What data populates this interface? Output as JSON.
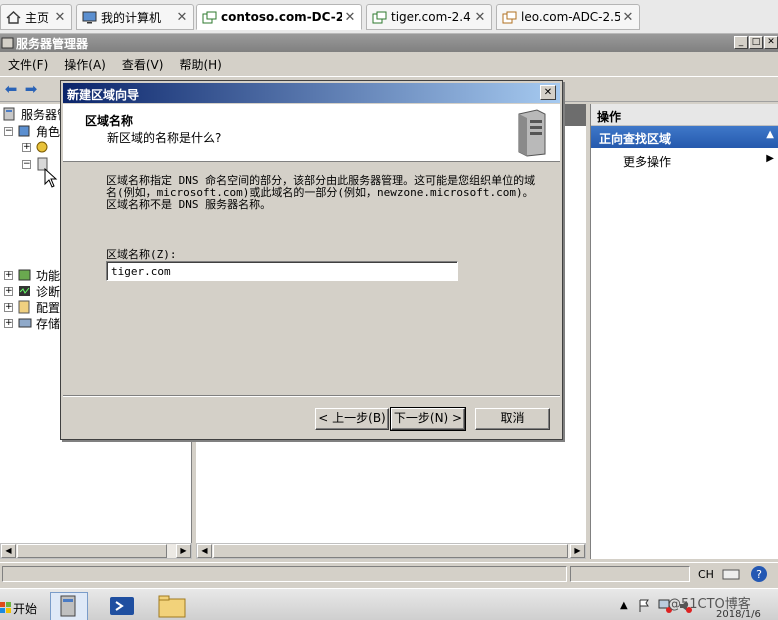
{
  "tabs": [
    {
      "label": "主页",
      "icon": "home-icon",
      "active": false
    },
    {
      "label": "我的计算机",
      "icon": "computer-icon",
      "active": false
    },
    {
      "label": "contoso.com-DC-2.2",
      "icon": "vm-icon",
      "active": true
    },
    {
      "label": "tiger.com-2.4",
      "icon": "vm-icon",
      "active": false
    },
    {
      "label": "leo.com-ADC-2.5",
      "icon": "vm-icon",
      "active": false
    }
  ],
  "window": {
    "title": "服务器管理器",
    "menu": [
      "文件(F)",
      "操作(A)",
      "查看(V)",
      "帮助(H)"
    ]
  },
  "tree": {
    "root": "服务器管",
    "roles": "角色",
    "features": "功能",
    "diagnostics": "诊断",
    "configuration": "配置",
    "storage": "存储"
  },
  "actions": {
    "header": "操作",
    "section": "正向查找区域",
    "more": "更多操作"
  },
  "dialog": {
    "title": "新建区域向导",
    "heading": "区域名称",
    "subheading": "新区域的名称是什么?",
    "description": "区域名称指定 DNS 命名空间的部分，该部分由此服务器管理。这可能是您组织单位的域名(例如，microsoft.com)或此域名的一部分(例如，newzone.microsoft.com)。区域名称不是 DNS 服务器名称。",
    "field_label": "区域名称(Z):",
    "field_value": "tiger.com",
    "back": "< 上一步(B)",
    "next": "下一步(N) >",
    "cancel": "取消"
  },
  "statusbar": {
    "lang": "CH"
  },
  "taskbar": {
    "start": "开始",
    "date": "2018/1/6",
    "watermark": "@51CTO博客"
  }
}
